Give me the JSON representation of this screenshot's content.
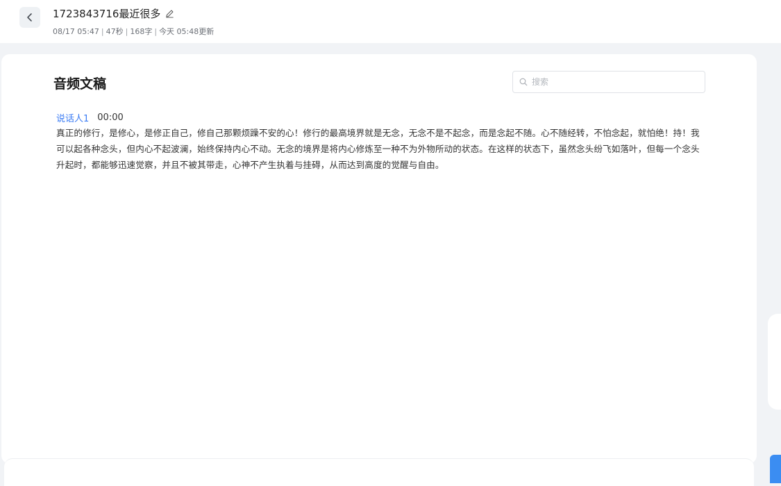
{
  "header": {
    "title": "1723843716最近很多",
    "meta": {
      "datetime": "08/17 05:47",
      "duration": "47秒",
      "word_count": "168字",
      "updated": "今天 05:48更新"
    }
  },
  "main": {
    "section_title": "音频文稿",
    "search": {
      "placeholder": "搜索",
      "value": ""
    },
    "segments": [
      {
        "speaker": "说话人1",
        "time": "00:00",
        "text": "真正的修行，是修心，是修正自己，修自己那颗烦躁不安的心！修行的最高境界就是无念，无念不是不起念，而是念起不随。心不随经转，不怕念起，就怕绝！持！我可以起各种念头，但内心不起波澜，始终保持内心不动。无念的境界是将内心修炼至一种不为外物所动的状态。在这样的状态下，虽然念头纷飞如落叶，但每一个念头升起时，都能够迅速觉察，并且不被其带走，心神不产生执着与挂碍，从而达到高度的觉醒与自由。"
      }
    ]
  },
  "colors": {
    "accent": "#3b7cf4",
    "background": "#f1f3f6"
  },
  "icons": {
    "back": "chevron-left-icon",
    "edit": "pencil-icon",
    "search": "search-icon"
  }
}
